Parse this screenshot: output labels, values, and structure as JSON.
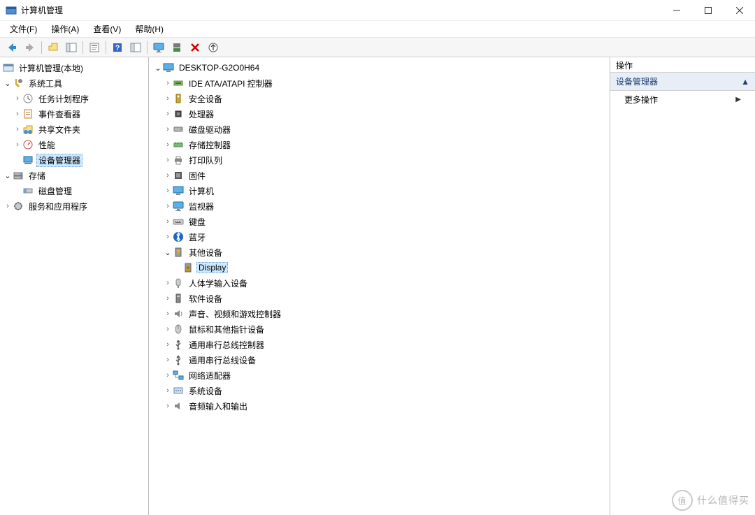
{
  "window": {
    "title": "计算机管理"
  },
  "menubar": {
    "items": [
      "文件(F)",
      "操作(A)",
      "查看(V)",
      "帮助(H)"
    ]
  },
  "left_tree": {
    "root": "计算机管理(本地)",
    "system_tools": {
      "label": "系统工具",
      "children": [
        "任务计划程序",
        "事件查看器",
        "共享文件夹",
        "性能",
        "设备管理器"
      ]
    },
    "storage": {
      "label": "存储",
      "children": [
        "磁盘管理"
      ]
    },
    "services": {
      "label": "服务和应用程序"
    },
    "selected": "设备管理器"
  },
  "device_tree": {
    "root": "DESKTOP-G2O0H64",
    "categories": [
      {
        "label": "IDE ATA/ATAPI 控制器",
        "icon": "ide"
      },
      {
        "label": "安全设备",
        "icon": "security"
      },
      {
        "label": "处理器",
        "icon": "cpu"
      },
      {
        "label": "磁盘驱动器",
        "icon": "disk"
      },
      {
        "label": "存储控制器",
        "icon": "storage"
      },
      {
        "label": "打印队列",
        "icon": "printer"
      },
      {
        "label": "固件",
        "icon": "firmware"
      },
      {
        "label": "计算机",
        "icon": "computer"
      },
      {
        "label": "监视器",
        "icon": "monitor"
      },
      {
        "label": "键盘",
        "icon": "keyboard"
      },
      {
        "label": "蓝牙",
        "icon": "bluetooth"
      },
      {
        "label": "其他设备",
        "icon": "other",
        "expanded": true,
        "children": [
          {
            "label": "Display",
            "icon": "warning",
            "selected": true
          }
        ]
      },
      {
        "label": "人体学输入设备",
        "icon": "hid"
      },
      {
        "label": "软件设备",
        "icon": "software"
      },
      {
        "label": "声音、视频和游戏控制器",
        "icon": "audio"
      },
      {
        "label": "鼠标和其他指针设备",
        "icon": "mouse"
      },
      {
        "label": "通用串行总线控制器",
        "icon": "usb"
      },
      {
        "label": "通用串行总线设备",
        "icon": "usb"
      },
      {
        "label": "网络适配器",
        "icon": "network"
      },
      {
        "label": "系统设备",
        "icon": "system"
      },
      {
        "label": "音频输入和输出",
        "icon": "speaker"
      }
    ]
  },
  "actions_pane": {
    "header": "操作",
    "category": "设备管理器",
    "more": "更多操作"
  },
  "watermark": "什么值得买"
}
